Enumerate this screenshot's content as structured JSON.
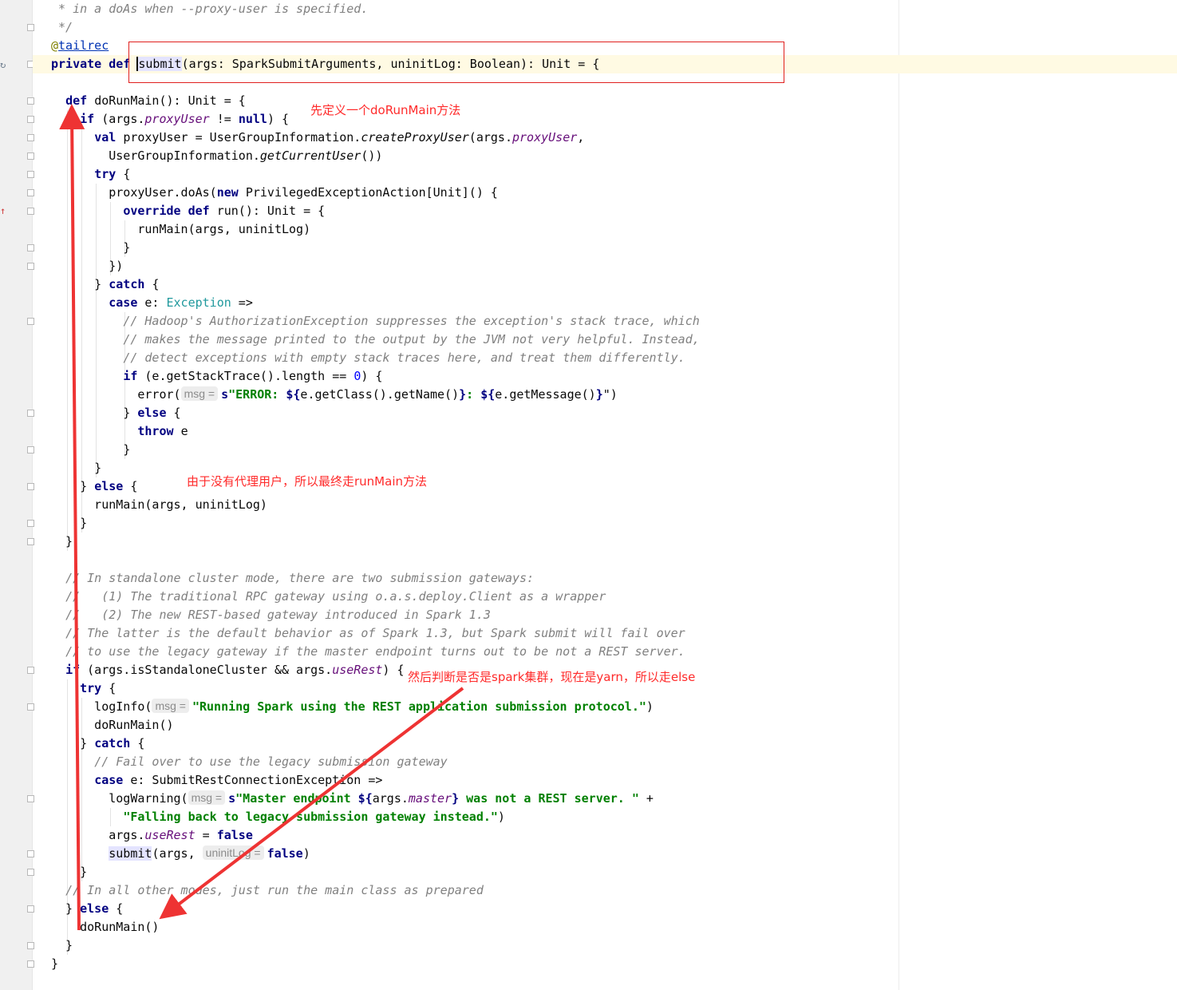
{
  "editor": {
    "lines": [
      [
        {
          "t": " * in a doAs when --proxy-user is specified.",
          "c": "cmt"
        }
      ],
      [
        {
          "t": " */",
          "c": "cmt"
        }
      ],
      [
        {
          "t": "@",
          "c": "ann"
        },
        {
          "t": "tailrec",
          "c": "link"
        }
      ],
      [
        {
          "t": "private def ",
          "c": "kw"
        },
        {
          "t": "",
          "c": "cursor"
        },
        {
          "t": "submit",
          "c": "hl"
        },
        {
          "t": "(args: SparkSubmitArguments, uninitLog: Boolean): Unit = {"
        }
      ],
      [
        {
          "t": ""
        }
      ],
      [
        {
          "t": "  "
        },
        {
          "t": "def ",
          "c": "kw"
        },
        {
          "t": "doRunMain(): Unit = {"
        }
      ],
      [
        {
          "t": "    "
        },
        {
          "t": "if ",
          "c": "kw"
        },
        {
          "t": "(args."
        },
        {
          "t": "proxyUser",
          "c": "fld"
        },
        {
          "t": " != "
        },
        {
          "t": "null",
          "c": "kw"
        },
        {
          "t": ") {"
        }
      ],
      [
        {
          "t": "      "
        },
        {
          "t": "val ",
          "c": "kw"
        },
        {
          "t": "proxyUser = UserGroupInformation."
        },
        {
          "t": "createProxyUser",
          "c": "ital"
        },
        {
          "t": "(args."
        },
        {
          "t": "proxyUser",
          "c": "fld"
        },
        {
          "t": ","
        }
      ],
      [
        {
          "t": "        UserGroupInformation."
        },
        {
          "t": "getCurrentUser",
          "c": "ital"
        },
        {
          "t": "())"
        }
      ],
      [
        {
          "t": "      "
        },
        {
          "t": "try ",
          "c": "kw"
        },
        {
          "t": "{"
        }
      ],
      [
        {
          "t": "        proxyUser.doAs("
        },
        {
          "t": "new ",
          "c": "kw"
        },
        {
          "t": "PrivilegedExceptionAction[Unit]() {"
        }
      ],
      [
        {
          "t": "          "
        },
        {
          "t": "override def ",
          "c": "kw"
        },
        {
          "t": "run(): Unit = {"
        }
      ],
      [
        {
          "t": "            runMain(args, uninitLog)"
        }
      ],
      [
        {
          "t": "          }"
        }
      ],
      [
        {
          "t": "        })"
        }
      ],
      [
        {
          "t": "      } "
        },
        {
          "t": "catch ",
          "c": "kw"
        },
        {
          "t": "{"
        }
      ],
      [
        {
          "t": "        "
        },
        {
          "t": "case ",
          "c": "kw"
        },
        {
          "t": "e: "
        },
        {
          "t": "Exception",
          "c": "typ"
        },
        {
          "t": " =>"
        }
      ],
      [
        {
          "t": "          "
        },
        {
          "t": "// Hadoop's AuthorizationException suppresses the exception's stack trace, which",
          "c": "cmt"
        }
      ],
      [
        {
          "t": "          "
        },
        {
          "t": "// makes the message printed to the output by the JVM not very helpful. Instead,",
          "c": "cmt"
        }
      ],
      [
        {
          "t": "          "
        },
        {
          "t": "// detect exceptions with empty stack traces here, and treat them differently.",
          "c": "cmt"
        }
      ],
      [
        {
          "t": "          "
        },
        {
          "t": "if ",
          "c": "kw"
        },
        {
          "t": "(e.getStackTrace().length == "
        },
        {
          "t": "0",
          "c": "num"
        },
        {
          "t": ") {"
        }
      ],
      [
        {
          "t": "            error("
        },
        {
          "t": "msg =",
          "c": "hint"
        },
        {
          "t": "s",
          "c": "kw"
        },
        {
          "t": "\"ERROR: ",
          "c": "str"
        },
        {
          "t": "${",
          "c": "kw"
        },
        {
          "t": "e.getClass().getName()"
        },
        {
          "t": "}",
          "c": "kw"
        },
        {
          "t": ": ",
          "c": "str"
        },
        {
          "t": "${",
          "c": "kw"
        },
        {
          "t": "e.getMessage()"
        },
        {
          "t": "}",
          "c": "kw"
        },
        {
          "t": "\")"
        }
      ],
      [
        {
          "t": "          } "
        },
        {
          "t": "else ",
          "c": "kw"
        },
        {
          "t": "{"
        }
      ],
      [
        {
          "t": "            "
        },
        {
          "t": "throw ",
          "c": "kw"
        },
        {
          "t": "e"
        }
      ],
      [
        {
          "t": "          }"
        }
      ],
      [
        {
          "t": "      }"
        }
      ],
      [
        {
          "t": "    } "
        },
        {
          "t": "else ",
          "c": "kw"
        },
        {
          "t": "{"
        }
      ],
      [
        {
          "t": "      runMain(args, uninitLog)"
        }
      ],
      [
        {
          "t": "    }"
        }
      ],
      [
        {
          "t": "  }"
        }
      ],
      [
        {
          "t": ""
        }
      ],
      [
        {
          "t": "  "
        },
        {
          "t": "// In standalone cluster mode, there are two submission gateways:",
          "c": "cmt"
        }
      ],
      [
        {
          "t": "  "
        },
        {
          "t": "//   (1) The traditional RPC gateway using o.a.s.deploy.Client as a wrapper",
          "c": "cmt"
        }
      ],
      [
        {
          "t": "  "
        },
        {
          "t": "//   (2) The new REST-based gateway introduced in Spark 1.3",
          "c": "cmt"
        }
      ],
      [
        {
          "t": "  "
        },
        {
          "t": "// The latter is the default behavior as of Spark 1.3, but Spark submit will fail over",
          "c": "cmt"
        }
      ],
      [
        {
          "t": "  "
        },
        {
          "t": "// to use the legacy gateway if the master endpoint turns out to be not a REST server.",
          "c": "cmt"
        }
      ],
      [
        {
          "t": "  "
        },
        {
          "t": "if ",
          "c": "kw"
        },
        {
          "t": "(args.isStandaloneCluster && args."
        },
        {
          "t": "useRest",
          "c": "fld"
        },
        {
          "t": ") {"
        }
      ],
      [
        {
          "t": "    "
        },
        {
          "t": "try ",
          "c": "kw"
        },
        {
          "t": "{"
        }
      ],
      [
        {
          "t": "      logInfo("
        },
        {
          "t": "msg =",
          "c": "hint"
        },
        {
          "t": "\"Running Spark using the REST application submission protocol.\"",
          "c": "str"
        },
        {
          "t": ")"
        }
      ],
      [
        {
          "t": "      doRunMain()"
        }
      ],
      [
        {
          "t": "    } "
        },
        {
          "t": "catch ",
          "c": "kw"
        },
        {
          "t": "{"
        }
      ],
      [
        {
          "t": "      "
        },
        {
          "t": "// Fail over to use the legacy submission gateway",
          "c": "cmt"
        }
      ],
      [
        {
          "t": "      "
        },
        {
          "t": "case ",
          "c": "kw"
        },
        {
          "t": "e: SubmitRestConnectionException =>"
        }
      ],
      [
        {
          "t": "        logWarning("
        },
        {
          "t": "msg =",
          "c": "hint"
        },
        {
          "t": "s",
          "c": "kw"
        },
        {
          "t": "\"Master endpoint ",
          "c": "str"
        },
        {
          "t": "${",
          "c": "kw"
        },
        {
          "t": "args."
        },
        {
          "t": "master",
          "c": "fld"
        },
        {
          "t": "}",
          "c": "kw"
        },
        {
          "t": " was not a REST server. \"",
          "c": "str"
        },
        {
          "t": " +"
        }
      ],
      [
        {
          "t": "          "
        },
        {
          "t": "\"Falling back to legacy submission gateway instead.\"",
          "c": "str"
        },
        {
          "t": ")"
        }
      ],
      [
        {
          "t": "        args."
        },
        {
          "t": "useRest",
          "c": "fld"
        },
        {
          "t": " = "
        },
        {
          "t": "false",
          "c": "kw"
        }
      ],
      [
        {
          "t": "        "
        },
        {
          "t": "submit",
          "c": "hl"
        },
        {
          "t": "(args, "
        },
        {
          "t": "uninitLog =",
          "c": "hint"
        },
        {
          "t": "false",
          "c": "kw"
        },
        {
          "t": ")"
        }
      ],
      [
        {
          "t": "    }"
        }
      ],
      [
        {
          "t": "  "
        },
        {
          "t": "// In all other modes, just run the main class as prepared",
          "c": "cmt"
        }
      ],
      [
        {
          "t": "  } "
        },
        {
          "t": "else ",
          "c": "kw"
        },
        {
          "t": "{"
        }
      ],
      [
        {
          "t": "    doRunMain()"
        }
      ],
      [
        {
          "t": "  }"
        }
      ],
      [
        {
          "t": "}"
        }
      ]
    ]
  },
  "annotations": {
    "note1": "先定义一个doRunMain方法",
    "note2": "由于没有代理用户，所以最终走runMain方法",
    "note3": "然后判断是否是spark集群，现在是yarn，所以走else"
  },
  "gutter": {
    "icons": [
      "recursive-call-icon",
      "override-up-arrow-icon"
    ]
  },
  "colors": {
    "keyword": "#000080",
    "comment": "#808080",
    "string": "#008000",
    "field": "#660e7a",
    "annotation_red": "#ff2a2a"
  }
}
